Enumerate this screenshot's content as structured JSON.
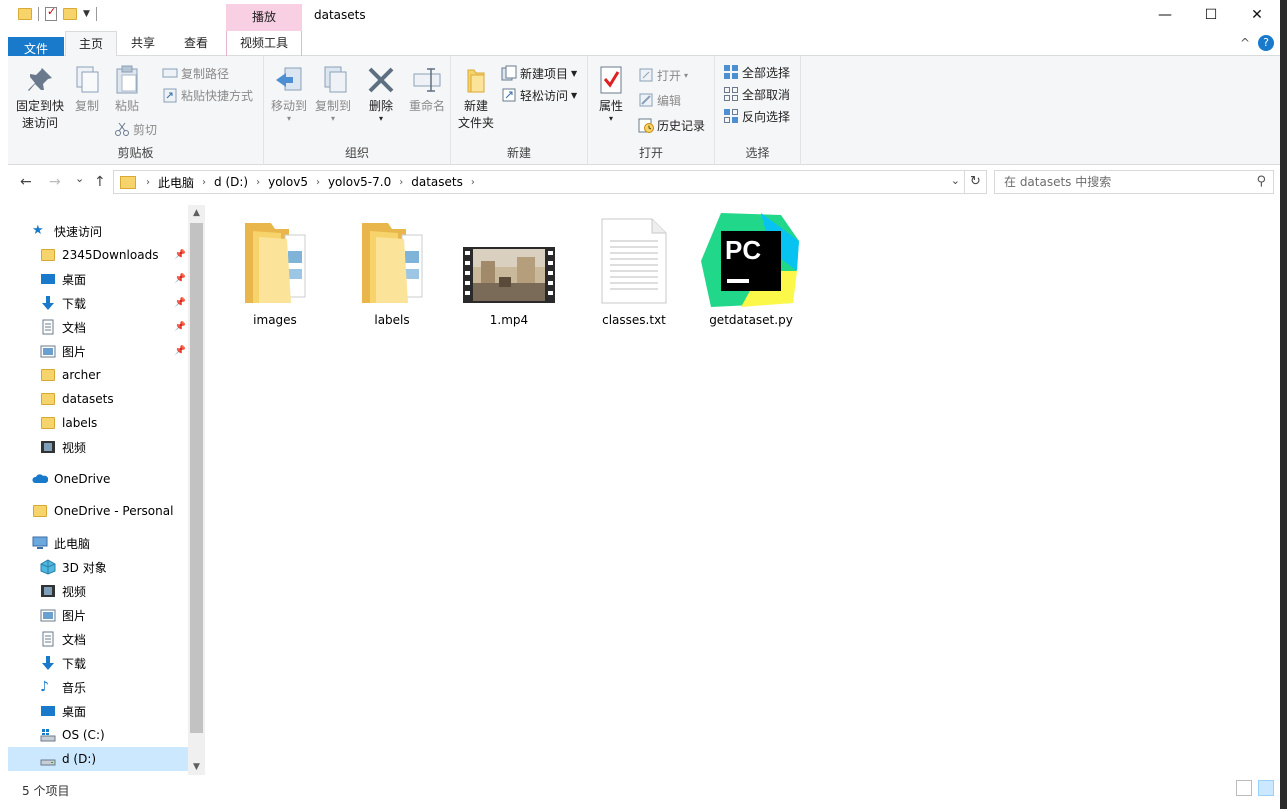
{
  "title_bar": {
    "contextual_tab": "播放",
    "window_title": "datasets",
    "minimize": "—",
    "maximize": "☐",
    "close": "✕"
  },
  "tabs": {
    "file": "文件",
    "home": "主页",
    "share": "共享",
    "view": "查看",
    "video_tools": "视频工具",
    "collapse": "^",
    "help": "?"
  },
  "ribbon": {
    "clipboard": {
      "label": "剪贴板",
      "pin_quick_access_1": "固定到快",
      "pin_quick_access_2": "速访问",
      "copy": "复制",
      "paste": "粘贴",
      "copy_path": "复制路径",
      "paste_shortcut": "粘贴快捷方式",
      "cut": "剪切"
    },
    "organize": {
      "label": "组织",
      "move_to": "移动到",
      "copy_to": "复制到",
      "delete": "删除",
      "rename": "重命名"
    },
    "new": {
      "label": "新建",
      "new_folder_1": "新建",
      "new_folder_2": "文件夹",
      "new_item": "新建项目",
      "easy_access": "轻松访问"
    },
    "open": {
      "label": "打开",
      "properties": "属性",
      "open": "打开",
      "edit": "编辑",
      "history": "历史记录"
    },
    "select": {
      "label": "选择",
      "select_all": "全部选择",
      "select_none": "全部取消",
      "invert": "反向选择"
    }
  },
  "address": {
    "back": "←",
    "forward": "→",
    "recent": "⌄",
    "up": "↑",
    "crumbs": [
      "此电脑",
      "d (D:)",
      "yolov5",
      "yolov5-7.0",
      "datasets"
    ],
    "search_placeholder": "在 datasets 中搜索"
  },
  "nav": {
    "quick_access": "快速访问",
    "items": [
      {
        "label": "2345Downloads"
      },
      {
        "label": "桌面"
      },
      {
        "label": "下载"
      },
      {
        "label": "文档"
      },
      {
        "label": "图片"
      },
      {
        "label": "archer"
      },
      {
        "label": "datasets"
      },
      {
        "label": "labels"
      },
      {
        "label": "视频"
      }
    ],
    "onedrive": "OneDrive",
    "onedrive_personal": "OneDrive - Personal",
    "this_pc": "此电脑",
    "pc_items": [
      {
        "label": "3D 对象"
      },
      {
        "label": "视频"
      },
      {
        "label": "图片"
      },
      {
        "label": "文档"
      },
      {
        "label": "下载"
      },
      {
        "label": "音乐"
      },
      {
        "label": "桌面"
      },
      {
        "label": "OS (C:)"
      },
      {
        "label": "d (D:)"
      }
    ]
  },
  "files": [
    {
      "name": "images"
    },
    {
      "name": "labels"
    },
    {
      "name": "1.mp4"
    },
    {
      "name": "classes.txt"
    },
    {
      "name": "getdataset.py",
      "logo_text": "PC"
    }
  ],
  "status": {
    "count": "5 个项目"
  },
  "colors": {
    "accent": "#1979ca",
    "selection": "#cce8ff",
    "context_tab": "#f9cfe3",
    "folder": "#f6d36b"
  }
}
